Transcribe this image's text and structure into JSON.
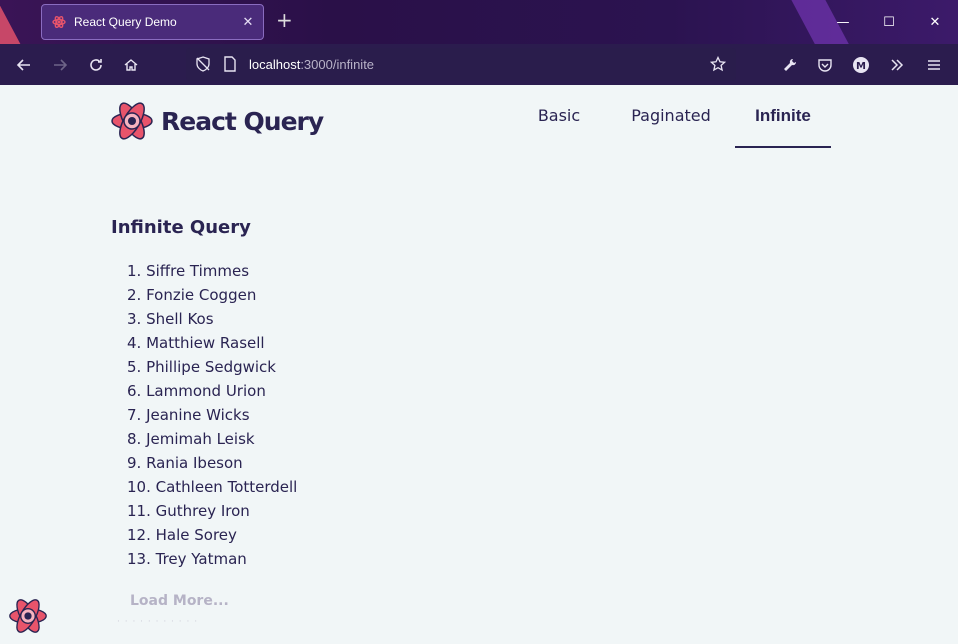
{
  "browser": {
    "tab_title": "React Query Demo",
    "tab_close": "✕",
    "new_tab": "+",
    "window_controls": {
      "minimize": "—",
      "maximize": "☐",
      "close": "✕"
    },
    "url_host": "localhost",
    "url_rest": ":3000/infinite",
    "nav_icons": [
      "back-arrow-icon",
      "forward-arrow-icon",
      "reload-icon",
      "home-icon"
    ],
    "toolbar_icons": [
      "bookmark-star-icon",
      "wrench-icon",
      "pocket-icon",
      "account-icon",
      "overflow-icon",
      "menu-icon"
    ],
    "account_initial": "M"
  },
  "header": {
    "brand": "React Query",
    "nav": [
      {
        "label": "Basic",
        "active": false
      },
      {
        "label": "Paginated",
        "active": false
      },
      {
        "label": "Infinite",
        "active": true
      }
    ]
  },
  "main": {
    "title": "Infinite Query",
    "people": [
      "1. Siffre Timmes",
      "2. Fonzie Coggen",
      "3. Shell Kos",
      "4. Matthiew Rasell",
      "5. Phillipe Sedgwick",
      "6. Lammond Urion",
      "7. Jeanine Wicks",
      "8. Jemimah Leisk",
      "9. Rania Ibeson",
      "10. Cathleen Totterdell",
      "11. Guthrey Iron",
      "12. Hale Sorey",
      "13. Trey Yatman"
    ],
    "load_more": "Load More..."
  },
  "colors": {
    "text": "#2a2452",
    "logo": "#e8546b",
    "page_bg": "#f1f6f7",
    "chrome": "#2b1c4e"
  }
}
